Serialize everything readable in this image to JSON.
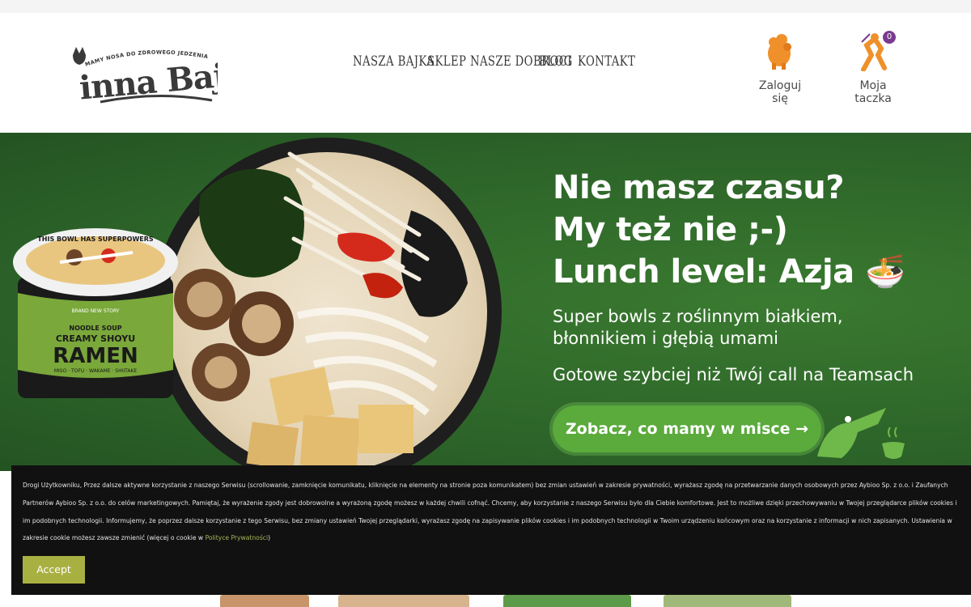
{
  "header": {
    "logo_tagline": "MAMY NOSA DO ZDROWEGO JEDZENIA",
    "logo_name": "inna Bajka",
    "nav": [
      {
        "label": "NASZA BAJKA"
      },
      {
        "label": "SKLEP NASZE DOBROCI"
      },
      {
        "label": "BLOG"
      },
      {
        "label": "KONTAKT"
      }
    ],
    "login_label": "Zaloguj się",
    "cart_label": "Moja taczka",
    "cart_count": "0"
  },
  "hero": {
    "headline_line1": "Nie masz czasu?",
    "headline_line2": "My też nie ;-)",
    "headline_line3": "Lunch level: Azja 🍜",
    "sub_line1": "Super bowls z roślinnym białkiem,",
    "sub_line2": "błonnikiem i głębią umami",
    "sub2": "Gotowe szybciej niż Twój call na Teamsach",
    "cta_label": "Zobacz, co mamy w misce →",
    "pack": {
      "rim_text": "THIS BOWL HAS SUPERPOWERS",
      "brand": "BRAND NEW STORY",
      "small": "NOODLE SOUP",
      "name1": "CREAMY SHOYU",
      "name2": "RAMEN",
      "ingredients": "MISO · TOFU · WAKAME · SHIITAKE"
    }
  },
  "cookie": {
    "text": "Drogi Użytkowniku, Przez dalsze aktywne korzystanie z naszego Serwisu (scrollowanie, zamknięcie komunikatu, kliknięcie na elementy na stronie poza komunikatem) bez zmian ustawień w zakresie prywatności, wyrażasz zgodę na przetwarzanie danych osobowych przez Aybioo Sp. z o.o. i Zaufanych Partnerów Aybioo Sp. z o.o. do celów marketingowych. Pamiętaj, że wyrażenie zgody jest dobrowolne a wyrażoną zgodę możesz w każdej chwili cofnąć. Chcemy, aby korzystanie z naszego Serwisu było dla Ciebie komfortowe. Jest to możliwe dzięki przechowywaniu w Twojej przeglądarce plików cookies i im podobnych technologii. Informujemy, że poprzez dalsze korzystanie z tego Serwisu, bez zmiany ustawień Twojej przeglądarki, wyrażasz zgodę na zapisywanie plików cookies i im podobnych technologii w Twoim urządzeniu końcowym oraz na korzystanie z informacji w nich zapisanych. Ustawienia w zakresie cookie możesz zawsze zmienić (więcej o cookie w ",
    "link": "Polityce Prywatności",
    "text_end": ")",
    "accept_label": "Accept"
  },
  "colors": {
    "hero_green": "#2f6b2c",
    "cta_green": "#5aaa3c",
    "accept": "#a9b042",
    "badge": "#7a3b8f",
    "mascot_orange": "#f0902a"
  }
}
